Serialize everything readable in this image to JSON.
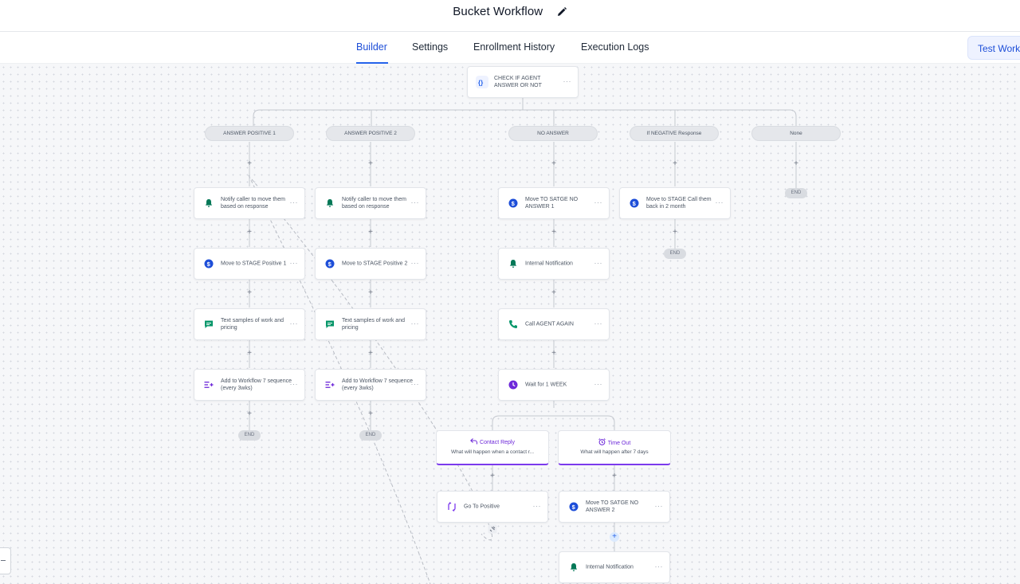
{
  "header": {
    "title": "Bucket Workflow",
    "edit_icon": "pencil-icon"
  },
  "tabs": [
    {
      "label": "Builder",
      "active": true
    },
    {
      "label": "Settings",
      "active": false
    },
    {
      "label": "Enrollment History",
      "active": false
    },
    {
      "label": "Execution Logs",
      "active": false
    }
  ],
  "test_button": {
    "label": "Test Workflow"
  },
  "colors": {
    "accent": "#2563eb",
    "branch_accent": "#7c3aed",
    "bell": "#047857",
    "dollar": "#1d4ed8",
    "message": "#059669",
    "clock": "#6d28d9"
  },
  "root_node": {
    "label": "CHECK IF AGENT ANSWER OR NOT",
    "icon": "code-braces-icon"
  },
  "branches": [
    {
      "label": "ANSWER POSITIVE 1"
    },
    {
      "label": "ANSWER POSITIVE 2"
    },
    {
      "label": "NO ANSWER"
    },
    {
      "label": "If NEGATIVE Response"
    },
    {
      "label": "None"
    }
  ],
  "end_label": "END",
  "more_label": "···",
  "plus_label": "+",
  "col1": [
    {
      "label": "Notify caller to move them based on response",
      "icon": "bell-icon"
    },
    {
      "label": "Move to STAGE Positive 1",
      "icon": "dollar-icon"
    },
    {
      "label": "Text samples of work and pricing",
      "icon": "message-icon"
    },
    {
      "label": "Add to Workflow 7 sequence (every 3wks)",
      "icon": "workflow-add-icon"
    }
  ],
  "col2": [
    {
      "label": "Notify caller to move them based on response",
      "icon": "bell-icon"
    },
    {
      "label": "Move to STAGE Positive 2",
      "icon": "dollar-icon"
    },
    {
      "label": "Text samples of work and pricing",
      "icon": "message-icon"
    },
    {
      "label": "Add to Workflow 7 sequence (every 3wks)",
      "icon": "workflow-add-icon"
    }
  ],
  "col3": [
    {
      "label": "Move TO SATGE NO ANSWER 1",
      "icon": "dollar-icon"
    },
    {
      "label": "Internal Notification",
      "icon": "bell-icon"
    },
    {
      "label": "Call AGENT AGAIN",
      "icon": "phone-icon"
    },
    {
      "label": "Wait for 1 WEEK",
      "icon": "clock-icon"
    }
  ],
  "col4": [
    {
      "label": "Move to STAGE Call them back in 2 month",
      "icon": "dollar-icon"
    }
  ],
  "wait_branches": [
    {
      "title": "Contact Reply",
      "desc": "What will happen when a contact r...",
      "icon": "reply-icon"
    },
    {
      "title": "Time Out",
      "desc": "What will happen after 7 days",
      "icon": "alarm-icon"
    }
  ],
  "after_reply": {
    "label": "Go To Positive",
    "icon": "goto-icon"
  },
  "after_timeout": [
    {
      "label": "Move TO SATGE NO ANSWER 2",
      "icon": "dollar-icon"
    },
    {
      "label": "Internal Notification",
      "icon": "bell-icon"
    }
  ]
}
